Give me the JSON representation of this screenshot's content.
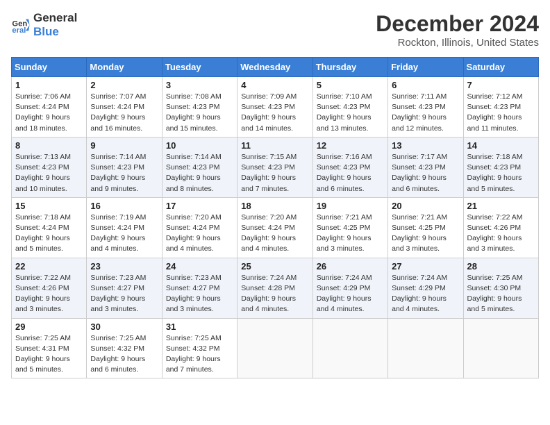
{
  "logo": {
    "line1": "General",
    "line2": "Blue"
  },
  "title": "December 2024",
  "location": "Rockton, Illinois, United States",
  "days_of_week": [
    "Sunday",
    "Monday",
    "Tuesday",
    "Wednesday",
    "Thursday",
    "Friday",
    "Saturday"
  ],
  "weeks": [
    [
      {
        "day": "1",
        "sunrise": "7:06 AM",
        "sunset": "4:24 PM",
        "daylight": "9 hours and 18 minutes."
      },
      {
        "day": "2",
        "sunrise": "7:07 AM",
        "sunset": "4:24 PM",
        "daylight": "9 hours and 16 minutes."
      },
      {
        "day": "3",
        "sunrise": "7:08 AM",
        "sunset": "4:23 PM",
        "daylight": "9 hours and 15 minutes."
      },
      {
        "day": "4",
        "sunrise": "7:09 AM",
        "sunset": "4:23 PM",
        "daylight": "9 hours and 14 minutes."
      },
      {
        "day": "5",
        "sunrise": "7:10 AM",
        "sunset": "4:23 PM",
        "daylight": "9 hours and 13 minutes."
      },
      {
        "day": "6",
        "sunrise": "7:11 AM",
        "sunset": "4:23 PM",
        "daylight": "9 hours and 12 minutes."
      },
      {
        "day": "7",
        "sunrise": "7:12 AM",
        "sunset": "4:23 PM",
        "daylight": "9 hours and 11 minutes."
      }
    ],
    [
      {
        "day": "8",
        "sunrise": "7:13 AM",
        "sunset": "4:23 PM",
        "daylight": "9 hours and 10 minutes."
      },
      {
        "day": "9",
        "sunrise": "7:14 AM",
        "sunset": "4:23 PM",
        "daylight": "9 hours and 9 minutes."
      },
      {
        "day": "10",
        "sunrise": "7:14 AM",
        "sunset": "4:23 PM",
        "daylight": "9 hours and 8 minutes."
      },
      {
        "day": "11",
        "sunrise": "7:15 AM",
        "sunset": "4:23 PM",
        "daylight": "9 hours and 7 minutes."
      },
      {
        "day": "12",
        "sunrise": "7:16 AM",
        "sunset": "4:23 PM",
        "daylight": "9 hours and 6 minutes."
      },
      {
        "day": "13",
        "sunrise": "7:17 AM",
        "sunset": "4:23 PM",
        "daylight": "9 hours and 6 minutes."
      },
      {
        "day": "14",
        "sunrise": "7:18 AM",
        "sunset": "4:23 PM",
        "daylight": "9 hours and 5 minutes."
      }
    ],
    [
      {
        "day": "15",
        "sunrise": "7:18 AM",
        "sunset": "4:24 PM",
        "daylight": "9 hours and 5 minutes."
      },
      {
        "day": "16",
        "sunrise": "7:19 AM",
        "sunset": "4:24 PM",
        "daylight": "9 hours and 4 minutes."
      },
      {
        "day": "17",
        "sunrise": "7:20 AM",
        "sunset": "4:24 PM",
        "daylight": "9 hours and 4 minutes."
      },
      {
        "day": "18",
        "sunrise": "7:20 AM",
        "sunset": "4:24 PM",
        "daylight": "9 hours and 4 minutes."
      },
      {
        "day": "19",
        "sunrise": "7:21 AM",
        "sunset": "4:25 PM",
        "daylight": "9 hours and 3 minutes."
      },
      {
        "day": "20",
        "sunrise": "7:21 AM",
        "sunset": "4:25 PM",
        "daylight": "9 hours and 3 minutes."
      },
      {
        "day": "21",
        "sunrise": "7:22 AM",
        "sunset": "4:26 PM",
        "daylight": "9 hours and 3 minutes."
      }
    ],
    [
      {
        "day": "22",
        "sunrise": "7:22 AM",
        "sunset": "4:26 PM",
        "daylight": "9 hours and 3 minutes."
      },
      {
        "day": "23",
        "sunrise": "7:23 AM",
        "sunset": "4:27 PM",
        "daylight": "9 hours and 3 minutes."
      },
      {
        "day": "24",
        "sunrise": "7:23 AM",
        "sunset": "4:27 PM",
        "daylight": "9 hours and 3 minutes."
      },
      {
        "day": "25",
        "sunrise": "7:24 AM",
        "sunset": "4:28 PM",
        "daylight": "9 hours and 4 minutes."
      },
      {
        "day": "26",
        "sunrise": "7:24 AM",
        "sunset": "4:29 PM",
        "daylight": "9 hours and 4 minutes."
      },
      {
        "day": "27",
        "sunrise": "7:24 AM",
        "sunset": "4:29 PM",
        "daylight": "9 hours and 4 minutes."
      },
      {
        "day": "28",
        "sunrise": "7:25 AM",
        "sunset": "4:30 PM",
        "daylight": "9 hours and 5 minutes."
      }
    ],
    [
      {
        "day": "29",
        "sunrise": "7:25 AM",
        "sunset": "4:31 PM",
        "daylight": "9 hours and 5 minutes."
      },
      {
        "day": "30",
        "sunrise": "7:25 AM",
        "sunset": "4:32 PM",
        "daylight": "9 hours and 6 minutes."
      },
      {
        "day": "31",
        "sunrise": "7:25 AM",
        "sunset": "4:32 PM",
        "daylight": "9 hours and 7 minutes."
      },
      null,
      null,
      null,
      null
    ]
  ],
  "labels": {
    "sunrise": "Sunrise:",
    "sunset": "Sunset:",
    "daylight": "Daylight:"
  }
}
